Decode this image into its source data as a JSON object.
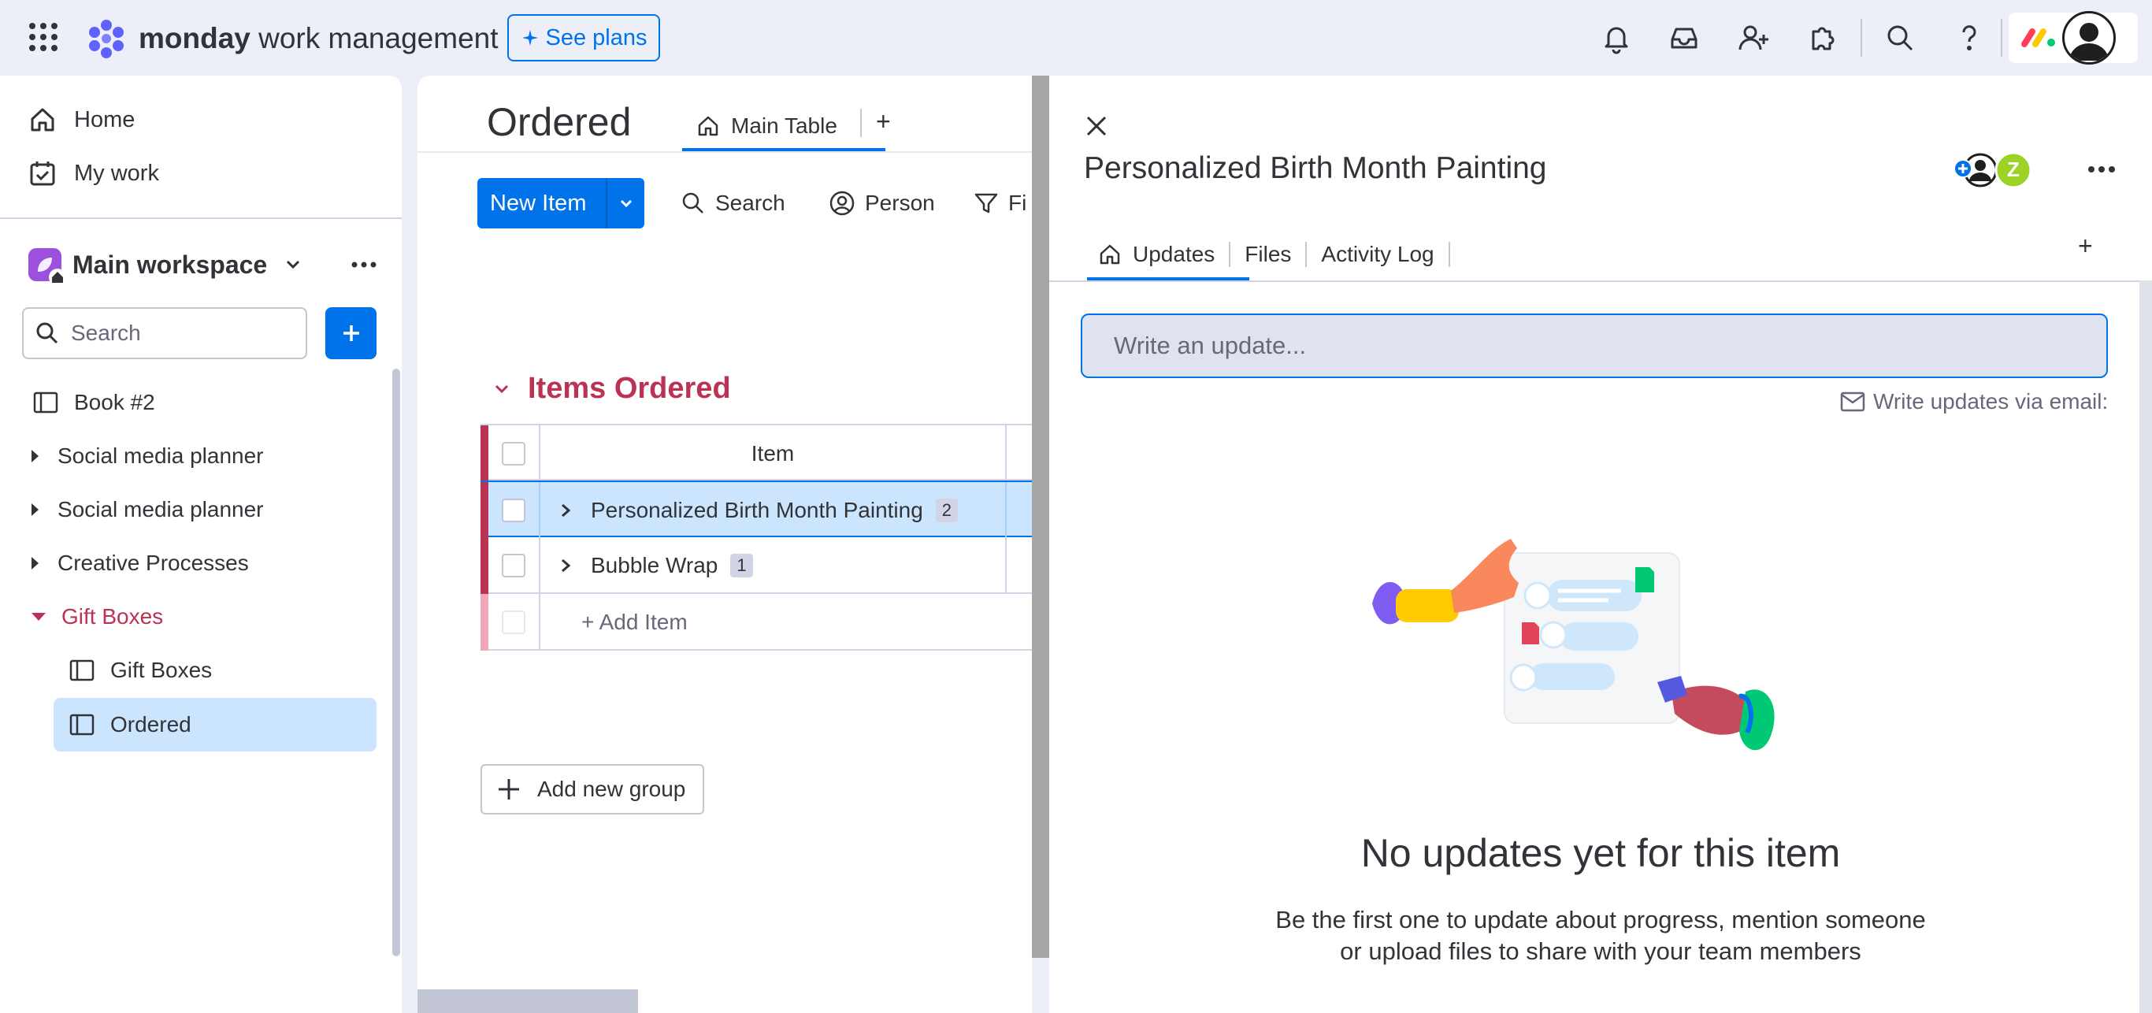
{
  "topbar": {
    "brand_bold": "monday",
    "brand_rest": " work management",
    "see_plans": "See plans",
    "colors": {
      "accent": "#0073ea",
      "background": "#eceff8"
    }
  },
  "sidebar": {
    "home": "Home",
    "my_work": "My work",
    "workspace": "Main workspace",
    "search_placeholder": "Search",
    "items": [
      {
        "label": "Book #2"
      },
      {
        "label": "Social media planner"
      },
      {
        "label": "Social media planner"
      },
      {
        "label": "Creative Processes"
      },
      {
        "label": "Gift Boxes"
      },
      {
        "label": "Gift Boxes"
      },
      {
        "label": "Ordered"
      }
    ]
  },
  "board": {
    "title": "Ordered",
    "tab_main": "Main Table",
    "tab_add": "+",
    "new_item": "New Item",
    "toolbar": {
      "search": "Search",
      "person": "Person",
      "filter": "Fi"
    },
    "group": {
      "title": "Items Ordered",
      "column_item": "Item",
      "rows": [
        {
          "name": "Personalized Birth Month Painting",
          "count": "2"
        },
        {
          "name": "Bubble Wrap",
          "count": "1"
        }
      ],
      "add_item": "+ Add Item"
    },
    "add_group": "Add new group",
    "group_color": "#bb3354"
  },
  "panel": {
    "title": "Personalized Birth Month Painting",
    "subscriber_initial": "Z",
    "tabs": [
      "Updates",
      "Files",
      "Activity Log"
    ],
    "tab_add": "+",
    "update_placeholder": "Write an update...",
    "email_link": "Write updates via email:",
    "empty_title": "No updates yet for this item",
    "empty_line1": "Be the first one to update about progress, mention someone",
    "empty_line2": "or upload files to share with your team members"
  }
}
